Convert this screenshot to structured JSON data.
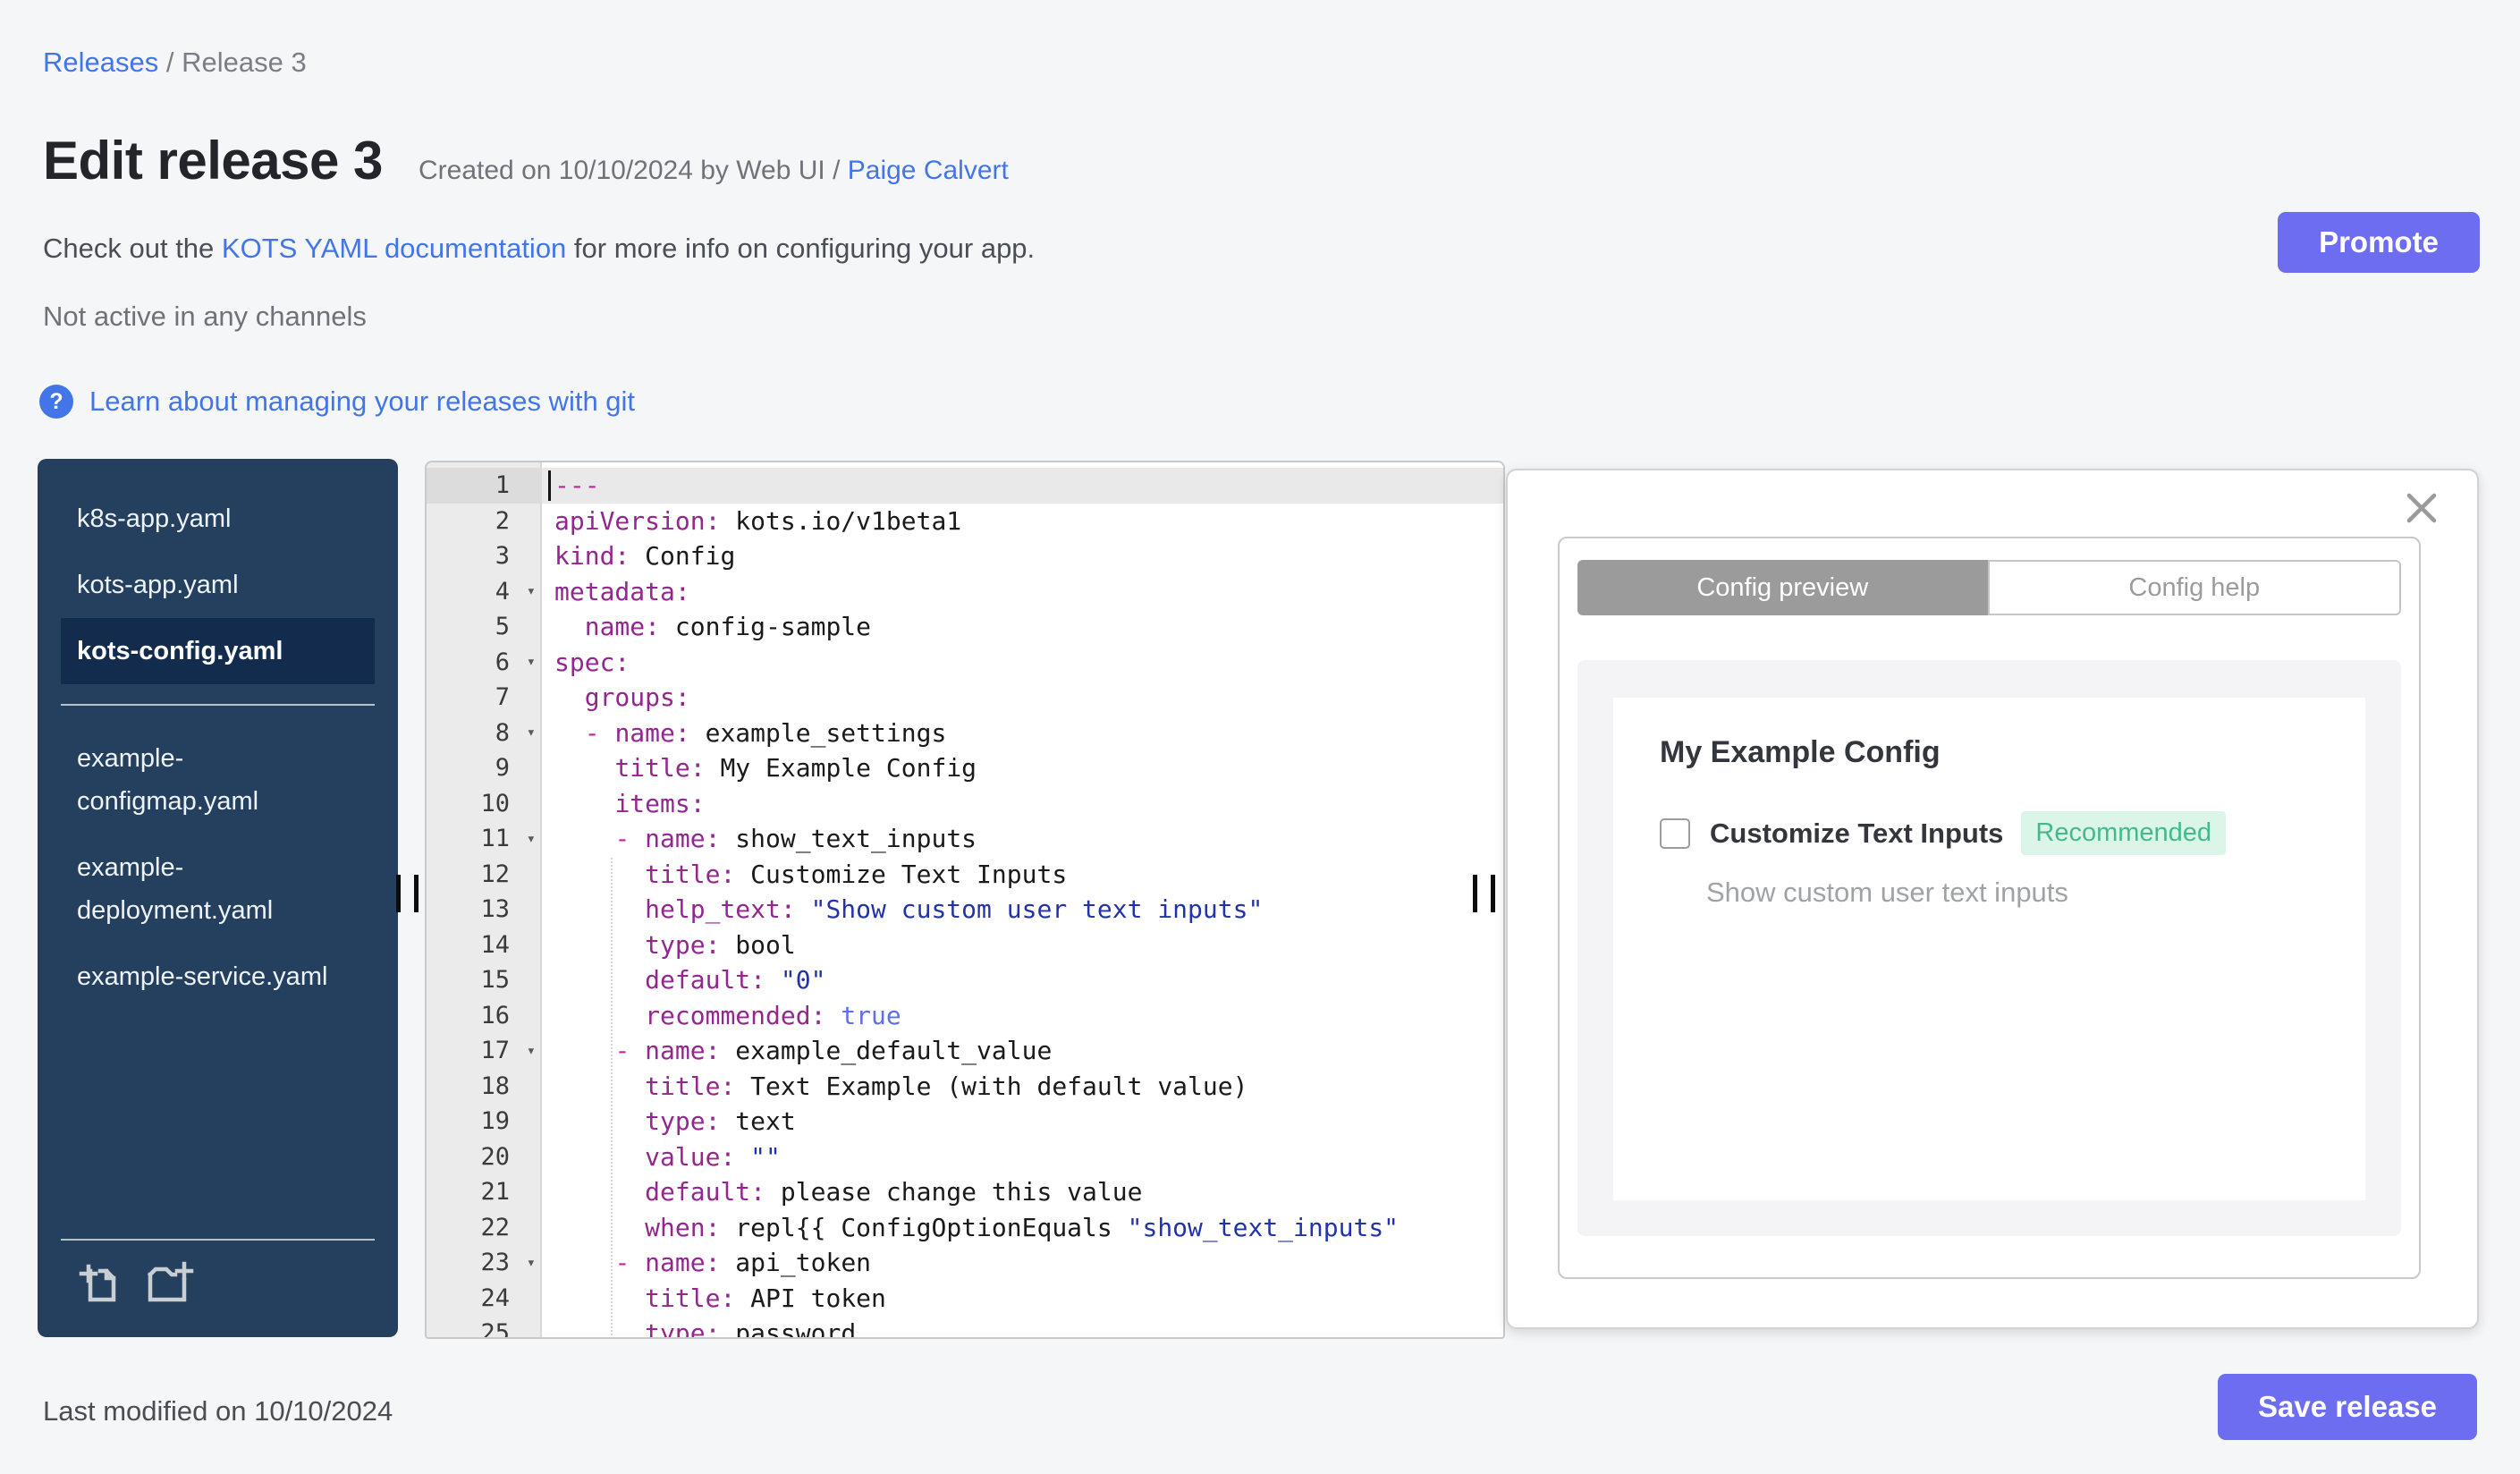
{
  "colors": {
    "accent": "#6d6df2",
    "link": "#4276e8",
    "sidebar_bg": "#24405e",
    "sidebar_selected_bg": "#132c4e",
    "badge_bg": "#dcf5e9",
    "badge_text": "#45ba87",
    "tab_active_bg": "#9b9b9b",
    "code_key": "#93278f",
    "code_doc": "#c12a9e",
    "code_string": "#2233aa",
    "code_bool": "#5e6fe8",
    "code_plain": "#1a1a1a"
  },
  "breadcrumb": {
    "link": "Releases",
    "separator": " / ",
    "current": "Release 3"
  },
  "header": {
    "title": "Edit release 3",
    "created_prefix": "Created on 10/10/2024 by Web UI / ",
    "created_link": "Paige Calvert",
    "docs_prefix": "Check out the ",
    "docs_link": "KOTS YAML documentation",
    "docs_suffix": " for more info on configuring your app.",
    "channel_status": "Not active in any channels",
    "git_help_icon": "?",
    "git_link": "Learn about managing your releases with git",
    "promote_label": "Promote"
  },
  "sidebar": {
    "files_top": [
      {
        "name": "k8s-app.yaml",
        "selected": false
      },
      {
        "name": "kots-app.yaml",
        "selected": false
      },
      {
        "name": "kots-config.yaml",
        "selected": true
      }
    ],
    "files_bottom": [
      {
        "name": "example-configmap.yaml",
        "selected": false
      },
      {
        "name": "example-deployment.yaml",
        "selected": false
      },
      {
        "name": "example-service.yaml",
        "selected": false
      }
    ],
    "icons": [
      "add-file-icon",
      "add-folder-icon"
    ]
  },
  "editor": {
    "active_line": 1,
    "fold_lines": [
      4,
      6,
      8,
      11,
      17,
      23
    ],
    "lines": [
      {
        "segments": [
          [
            "doc",
            "---"
          ]
        ]
      },
      {
        "segments": [
          [
            "key",
            "apiVersion:"
          ],
          [
            "plain",
            " kots.io/v1beta1"
          ]
        ]
      },
      {
        "segments": [
          [
            "key",
            "kind:"
          ],
          [
            "plain",
            " Config"
          ]
        ]
      },
      {
        "segments": [
          [
            "key",
            "metadata:"
          ]
        ]
      },
      {
        "segments": [
          [
            "plain",
            "  "
          ],
          [
            "key",
            "name:"
          ],
          [
            "plain",
            " config-sample"
          ]
        ]
      },
      {
        "segments": [
          [
            "key",
            "spec:"
          ]
        ]
      },
      {
        "segments": [
          [
            "plain",
            "  "
          ],
          [
            "key",
            "groups:"
          ]
        ]
      },
      {
        "segments": [
          [
            "plain",
            "  "
          ],
          [
            "dash",
            "- "
          ],
          [
            "key",
            "name:"
          ],
          [
            "plain",
            " example_settings"
          ]
        ]
      },
      {
        "segments": [
          [
            "plain",
            "    "
          ],
          [
            "key",
            "title:"
          ],
          [
            "plain",
            " My Example Config"
          ]
        ]
      },
      {
        "segments": [
          [
            "plain",
            "    "
          ],
          [
            "key",
            "items:"
          ]
        ]
      },
      {
        "segments": [
          [
            "plain",
            "    "
          ],
          [
            "dash",
            "- "
          ],
          [
            "key",
            "name:"
          ],
          [
            "plain",
            " show_text_inputs"
          ]
        ]
      },
      {
        "segments": [
          [
            "plain",
            "      "
          ],
          [
            "key",
            "title:"
          ],
          [
            "plain",
            " Customize Text Inputs"
          ]
        ]
      },
      {
        "segments": [
          [
            "plain",
            "      "
          ],
          [
            "key",
            "help_text:"
          ],
          [
            "plain",
            " "
          ],
          [
            "str",
            "\"Show custom user text inputs\""
          ]
        ]
      },
      {
        "segments": [
          [
            "plain",
            "      "
          ],
          [
            "key",
            "type:"
          ],
          [
            "plain",
            " bool"
          ]
        ]
      },
      {
        "segments": [
          [
            "plain",
            "      "
          ],
          [
            "key",
            "default:"
          ],
          [
            "plain",
            " "
          ],
          [
            "str",
            "\"0\""
          ]
        ]
      },
      {
        "segments": [
          [
            "plain",
            "      "
          ],
          [
            "key",
            "recommended:"
          ],
          [
            "plain",
            " "
          ],
          [
            "bool",
            "true"
          ]
        ]
      },
      {
        "segments": [
          [
            "plain",
            "    "
          ],
          [
            "dash",
            "- "
          ],
          [
            "key",
            "name:"
          ],
          [
            "plain",
            " example_default_value"
          ]
        ]
      },
      {
        "segments": [
          [
            "plain",
            "      "
          ],
          [
            "key",
            "title:"
          ],
          [
            "plain",
            " Text Example (with default value)"
          ]
        ]
      },
      {
        "segments": [
          [
            "plain",
            "      "
          ],
          [
            "key",
            "type:"
          ],
          [
            "plain",
            " text"
          ]
        ]
      },
      {
        "segments": [
          [
            "plain",
            "      "
          ],
          [
            "key",
            "value:"
          ],
          [
            "plain",
            " "
          ],
          [
            "str",
            "\"\""
          ]
        ]
      },
      {
        "segments": [
          [
            "plain",
            "      "
          ],
          [
            "key",
            "default:"
          ],
          [
            "plain",
            " please change this value"
          ]
        ]
      },
      {
        "segments": [
          [
            "plain",
            "      "
          ],
          [
            "key",
            "when:"
          ],
          [
            "plain",
            " repl{{ ConfigOptionEquals "
          ],
          [
            "str",
            "\"show_text_inputs\""
          ]
        ]
      },
      {
        "segments": [
          [
            "plain",
            "    "
          ],
          [
            "dash",
            "- "
          ],
          [
            "key",
            "name:"
          ],
          [
            "plain",
            " api_token"
          ]
        ]
      },
      {
        "segments": [
          [
            "plain",
            "      "
          ],
          [
            "key",
            "title:"
          ],
          [
            "plain",
            " API token"
          ]
        ]
      },
      {
        "segments": [
          [
            "plain",
            "      "
          ],
          [
            "key",
            "type:"
          ],
          [
            "plain",
            " password"
          ]
        ]
      }
    ]
  },
  "preview_panel": {
    "tabs": [
      {
        "label": "Config preview",
        "active": true
      },
      {
        "label": "Config help",
        "active": false
      }
    ],
    "group_title": "My Example Config",
    "item_label": "Customize Text Inputs",
    "item_checked": false,
    "badge": "Recommended",
    "help_text": "Show custom user text inputs",
    "close_icon": "close-icon"
  },
  "footer": {
    "last_modified": "Last modified on 10/10/2024",
    "save_label": "Save release"
  }
}
